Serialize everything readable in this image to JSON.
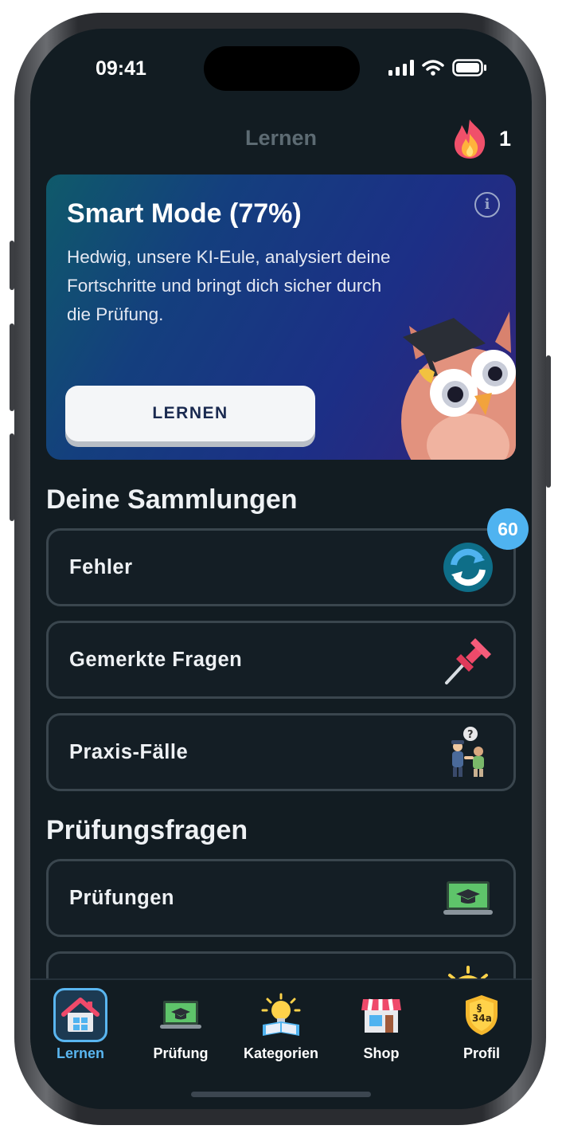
{
  "status_bar": {
    "time": "09:41"
  },
  "header": {
    "title": "Lernen",
    "streak_count": "1"
  },
  "smart_mode": {
    "title": "Smart Mode (77%)",
    "description": "Hedwig, unsere KI-Eule, analysiert deine Fortschritte und bringt dich sicher durch die Prüfung.",
    "button_label": "LERNEN",
    "info_glyph": "i"
  },
  "collections": {
    "title": "Deine Sammlungen",
    "items": [
      {
        "label": "Fehler",
        "icon": "refresh-icon",
        "badge": "60"
      },
      {
        "label": "Gemerkte Fragen",
        "icon": "pushpin-icon"
      },
      {
        "label": "Praxis-Fälle",
        "icon": "people-conversation-icon"
      }
    ]
  },
  "exam_questions": {
    "title": "Prüfungsfragen",
    "items": [
      {
        "label": "Prüfungen",
        "icon": "laptop-graduation-icon"
      },
      {
        "label": "",
        "icon": "lightbulb-icon"
      }
    ]
  },
  "tabbar": {
    "items": [
      {
        "label": "Lernen",
        "icon": "home-icon",
        "active": true
      },
      {
        "label": "Prüfung",
        "icon": "laptop-graduation-icon"
      },
      {
        "label": "Kategorien",
        "icon": "lightbulb-book-icon"
      },
      {
        "label": "Shop",
        "icon": "shop-icon"
      },
      {
        "label": "Profil",
        "icon": "shield-34a-icon"
      }
    ]
  },
  "colors": {
    "background": "#121c22",
    "accent": "#5ab6f0",
    "badge": "#4fb3f0"
  }
}
